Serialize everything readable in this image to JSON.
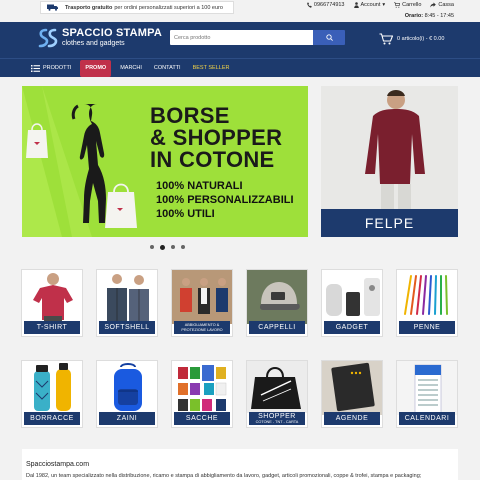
{
  "topbar": {
    "shipping_bold": "Trasporto gratuito",
    "shipping_text": "per ordini personalizzati superiori a 100 euro",
    "phone": "0966774913",
    "account": "Account",
    "cart": "Carrello",
    "checkout": "Cassa",
    "hours_label": "Orario:",
    "hours_value": "8:45 - 17:45"
  },
  "header": {
    "logo_title": "SPACCIO STAMPA",
    "logo_subtitle": "clothes and gadgets",
    "search_placeholder": "Cerca prodotto",
    "cart_summary": "0 articolo(i) - € 0.00"
  },
  "nav": {
    "items": [
      "PRODOTTI",
      "PROMO",
      "MARCHI",
      "CONTATTI",
      "BEST SELLER"
    ]
  },
  "hero": {
    "main_title_line1": "BORSE",
    "main_title_line2": "& SHOPPER",
    "main_title_line3": "IN COTONE",
    "bullets": [
      "100% NATURALI",
      "100% PERSONALIZZABILI",
      "100% UTILI"
    ],
    "side_label": "FELPE",
    "slides_count": 4,
    "active_slide": 2
  },
  "categories": [
    {
      "label": "T-SHIRT"
    },
    {
      "label": "SOFTSHELL"
    },
    {
      "label": "ABBIGLIAMENTO & PROTEZIONE LAVORO"
    },
    {
      "label": "CAPPELLI"
    },
    {
      "label": "GADGET"
    },
    {
      "label": "PENNE"
    },
    {
      "label": "BORRACCE"
    },
    {
      "label": "ZAINI"
    },
    {
      "label": "SACCHE"
    },
    {
      "label": "SHOPPER",
      "sub": "COTONE - TNT - CARTA"
    },
    {
      "label": "AGENDE"
    },
    {
      "label": "CALENDARI"
    }
  ],
  "about": {
    "title": "Spacciostampa.com",
    "text": "Dal 1982, un team specializzato nella distribuzione, ricamo e stampa di abbigliamento da lavoro, gadget, articoli promozionali, coppe & trofei, stampa e packaging;"
  },
  "colors": {
    "navy": "#1d3a6d",
    "promo": "#c0304a",
    "best_seller": "#f5d547",
    "hero_green": "#9ee03a",
    "search_button": "#3a5fb8"
  }
}
